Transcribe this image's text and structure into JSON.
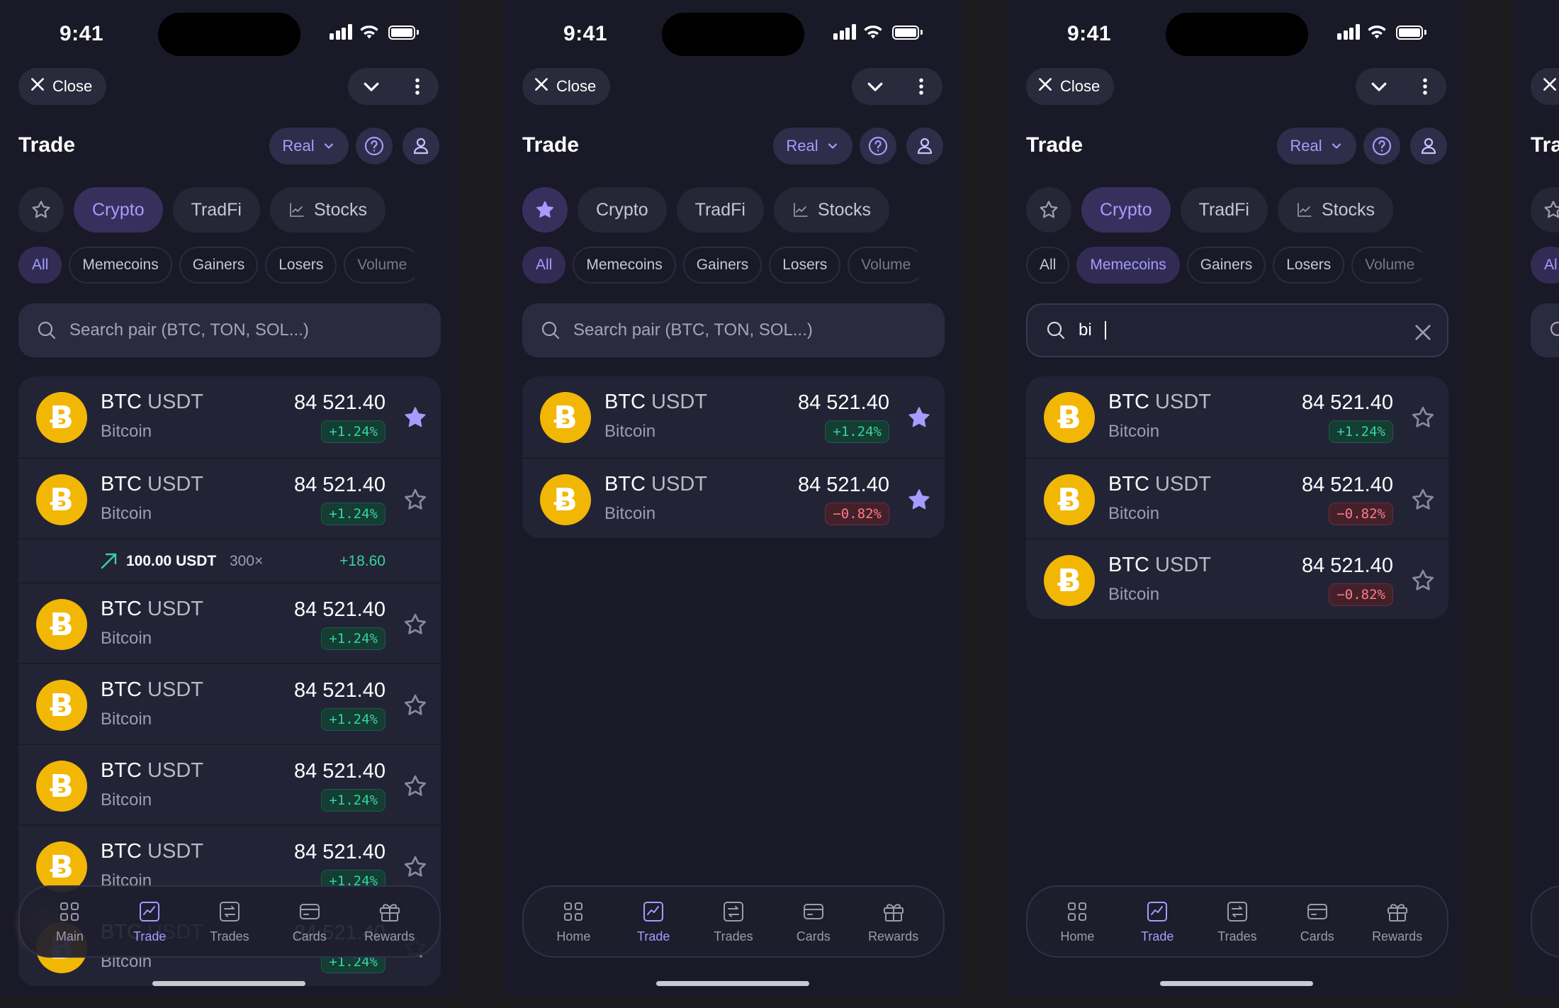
{
  "status": {
    "time": "9:41"
  },
  "topbar": {
    "close_label": "Close"
  },
  "header": {
    "title": "Trade",
    "mode_label": "Real"
  },
  "categories": [
    "Crypto",
    "TradFi",
    "Stocks"
  ],
  "filters": [
    "All",
    "Memecoins",
    "Gainers",
    "Losers",
    "Volume"
  ],
  "search": {
    "placeholder": "Search pair (BTC, TON, SOL...)",
    "typed_value": "bi"
  },
  "asset": {
    "base": "BTC",
    "quote": "USDT",
    "name": "Bitcoin",
    "price": "84 521.40"
  },
  "changes": {
    "up": "+1.24%",
    "down": "−0.82%"
  },
  "position": {
    "amount": "100.00 USDT",
    "leverage": "300×",
    "pnl": "+18.60"
  },
  "nav": [
    "Main",
    "Trade",
    "Trades",
    "Cards",
    "Rewards"
  ],
  "nav_alt_first": "Home",
  "partial_screen": {
    "title_fragment": "Tra",
    "filter_fragment": "Al"
  },
  "colors": {
    "accent": "#a59cff",
    "positive": "#38d39f",
    "negative": "#ff7b8a",
    "bitcoin": "#f2b705",
    "background": "#191927"
  },
  "screens": [
    {
      "category_active": "Crypto",
      "star_tab_active": false,
      "filter_active": "All",
      "search_state": "placeholder",
      "first_nav_label": "Main",
      "rows": [
        {
          "change": "up",
          "favorite": true
        },
        {
          "change": "up",
          "favorite": false,
          "position": true
        },
        {
          "change": "up",
          "favorite": false
        },
        {
          "change": "up",
          "favorite": false
        },
        {
          "change": "up",
          "favorite": false
        },
        {
          "change": "up",
          "favorite": false
        },
        {
          "change": "up",
          "favorite": false
        }
      ]
    },
    {
      "category_active": "Favorites",
      "star_tab_active": true,
      "filter_active": "All",
      "search_state": "placeholder",
      "first_nav_label": "Home",
      "rows": [
        {
          "change": "up",
          "favorite": true
        },
        {
          "change": "down",
          "favorite": true
        }
      ]
    },
    {
      "category_active": "Crypto",
      "star_tab_active": false,
      "filter_active": "Memecoins",
      "search_state": "typed",
      "first_nav_label": "Home",
      "rows": [
        {
          "change": "up",
          "favorite": false
        },
        {
          "change": "down",
          "favorite": false
        },
        {
          "change": "down",
          "favorite": false
        }
      ]
    }
  ]
}
